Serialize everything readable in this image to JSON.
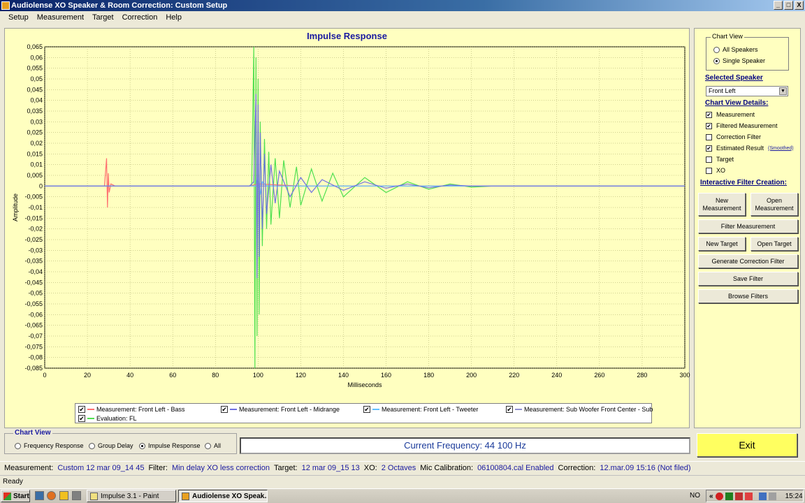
{
  "window": {
    "title": "Audiolense XO Speaker & Room Correction: Custom Setup",
    "buttons": [
      "_",
      "□",
      "X"
    ]
  },
  "menu": [
    "Setup",
    "Measurement",
    "Target",
    "Correction",
    "Help"
  ],
  "chart_data": {
    "type": "line",
    "title": "Impulse Response",
    "xlabel": "Milliseconds",
    "ylabel": "Amplitude",
    "xlim": [
      0,
      300
    ],
    "ylim": [
      -0.085,
      0.065
    ],
    "grid": true,
    "x_ticks": [
      "0",
      "20",
      "40",
      "60",
      "80",
      "100",
      "120",
      "140",
      "160",
      "180",
      "200",
      "220",
      "240",
      "260",
      "280",
      "300"
    ],
    "y_ticks": [
      "0,065",
      "0,06",
      "0,055",
      "0,05",
      "0,045",
      "0,04",
      "0,035",
      "0,03",
      "0,025",
      "0,02",
      "0,015",
      "0,01",
      "0,005",
      "0",
      "-0,005",
      "-0,01",
      "-0,015",
      "-0,02",
      "-0,025",
      "-0,03",
      "-0,035",
      "-0,04",
      "-0,045",
      "-0,05",
      "-0,055",
      "-0,06",
      "-0,065",
      "-0,07",
      "-0,075",
      "-0,08",
      "-0,085"
    ],
    "series": [
      {
        "name": "Measurement: Front Left - Bass",
        "color": "#ff7070",
        "x": [
          0,
          28,
          29,
          29.4,
          29.8,
          30.2,
          31,
          33,
          40,
          96,
          100,
          120,
          300
        ],
        "y": [
          0,
          0,
          0.013,
          -0.01,
          0.006,
          -0.003,
          0.001,
          0,
          0,
          0,
          0.001,
          0,
          0
        ]
      },
      {
        "name": "Measurement: Front Left - Midrange",
        "color": "#7070e0",
        "x": [
          0,
          96,
          98,
          99,
          99.5,
          100,
          100.5,
          101,
          102,
          103,
          104,
          106,
          108,
          110,
          115,
          120,
          125,
          130,
          140,
          150,
          160,
          170,
          180,
          190,
          200,
          300
        ],
        "y": [
          0,
          0,
          0.002,
          0.043,
          -0.043,
          0.038,
          -0.033,
          0.025,
          -0.02,
          0.015,
          -0.013,
          0.01,
          -0.008,
          0.007,
          -0.005,
          0.004,
          -0.003,
          0.003,
          -0.002,
          0.002,
          -0.001,
          0.001,
          -0.0008,
          0.0005,
          0,
          0
        ]
      },
      {
        "name": "Measurement: Front Left - Tweeter",
        "color": "#60c0ff",
        "x": [
          0,
          99,
          100,
          101,
          102,
          104,
          300
        ],
        "y": [
          0,
          0,
          0.004,
          -0.004,
          0.002,
          0,
          0
        ]
      },
      {
        "name": "Measurement: Sub Woofer Front Center - Sub",
        "color": "#9090d0",
        "x": [
          0,
          300
        ],
        "y": [
          0,
          0
        ]
      },
      {
        "name": "Evaluation: FL",
        "color": "#50e050",
        "x": [
          0,
          97,
          98,
          98.5,
          99,
          99.5,
          100,
          100.5,
          101,
          102,
          103,
          104,
          105,
          106,
          108,
          110,
          112,
          115,
          118,
          120,
          125,
          130,
          135,
          140,
          150,
          160,
          170,
          180,
          190,
          200,
          210,
          300
        ],
        "y": [
          0,
          0,
          0.065,
          -0.085,
          0.06,
          -0.07,
          0.05,
          -0.06,
          0.03,
          -0.028,
          0.022,
          -0.02,
          0.016,
          -0.018,
          0.013,
          -0.015,
          0.012,
          -0.01,
          0.009,
          -0.009,
          0.008,
          -0.007,
          0.006,
          -0.005,
          0.004,
          -0.003,
          0.002,
          -0.0015,
          0.001,
          -0.0005,
          0,
          0
        ]
      }
    ],
    "legend_checked": [
      true,
      true,
      true,
      true,
      true
    ]
  },
  "side": {
    "chart_view_title": "Chart View",
    "all_speakers": "All Speakers",
    "single_speaker": "Single Speaker",
    "selected_speaker_label": "Selected Speaker",
    "selected_speaker_value": "Front Left",
    "details_label": "Chart View Details:",
    "checks": [
      {
        "label": "Measurement",
        "checked": true
      },
      {
        "label": "Filtered Measurement",
        "checked": true
      },
      {
        "label": "Correction Filter",
        "checked": false
      },
      {
        "label": "Estimated Result",
        "checked": true
      },
      {
        "label": "Target",
        "checked": false
      },
      {
        "label": "XO",
        "checked": false
      }
    ],
    "smoothed": "(Smoothed)",
    "interactive_label": "Interactive Filter Creation:",
    "buttons": {
      "new_measurement": "New Measurement",
      "open_measurement": "Open Measurement",
      "filter_measurement": "Filter Measurement",
      "new_target": "New Target",
      "open_target": "Open Target",
      "generate_correction": "Generate Correction Filter",
      "save_filter": "Save Filter",
      "browse_filters": "Browse Filters"
    }
  },
  "bottom": {
    "chart_view_title": "Chart View",
    "views": [
      "Frequency Response",
      "Group Delay",
      "Impulse Response",
      "All"
    ],
    "selected_view": "Impulse Response",
    "current_frequency": "Current Frequency:  44 100 Hz",
    "exit": "Exit"
  },
  "infobar": [
    {
      "label": "Measurement:",
      "value": "Custom 12 mar 09_14 45"
    },
    {
      "label": "Filter:",
      "value": "Min delay XO  less correction"
    },
    {
      "label": "Target:",
      "value": "12 mar 09_15 13"
    },
    {
      "label": "XO:",
      "value": "2 Octaves"
    },
    {
      "label": "Mic Calibration:",
      "value": "06100804.cal Enabled"
    },
    {
      "label": "Correction:",
      "value": "12.mar.09 15:16 (Not filed)"
    }
  ],
  "status": "Ready",
  "taskbar": {
    "start": "Start",
    "tasks": [
      "Impulse 3.1 - Paint",
      "Audiolense XO Speak..."
    ],
    "tray_lang": "NO",
    "tray_arrows": "«",
    "clock": "15:24"
  }
}
